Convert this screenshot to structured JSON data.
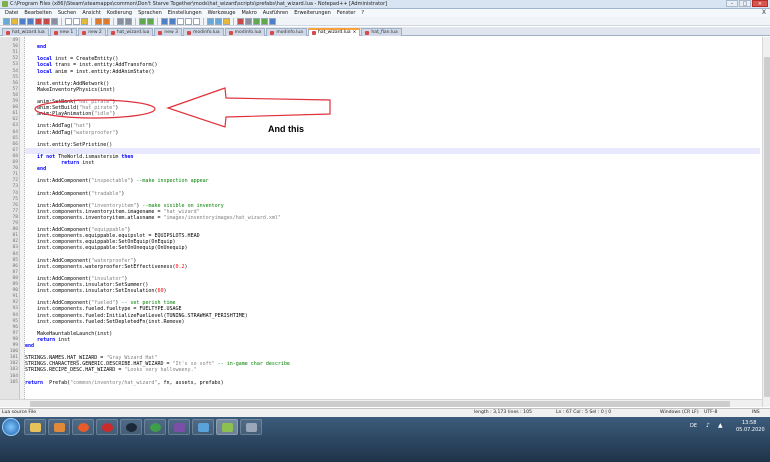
{
  "window": {
    "title": "C:\\Program Files (x86)\\Steam\\steamapps\\common\\Don't Starve Together\\mods\\hat_wizard\\scripts\\prefabs\\hat_wizard.lua - Notepad++ [Administrator]",
    "controls": [
      "–",
      "□",
      "×"
    ]
  },
  "menu": {
    "items": [
      "Datei",
      "Bearbeiten",
      "Suchen",
      "Ansicht",
      "Kodierung",
      "Sprachen",
      "Einstellungen",
      "Werkzeuge",
      "Makro",
      "Ausführen",
      "Erweiterungen",
      "Fenster",
      "?"
    ],
    "close": "X"
  },
  "tabs": [
    {
      "label": "hat_wizard.lua",
      "active": false
    },
    {
      "label": "new 1",
      "active": false
    },
    {
      "label": "new 2",
      "active": false
    },
    {
      "label": "hat_wizard.lua",
      "active": false
    },
    {
      "label": "new 3",
      "active": false
    },
    {
      "label": "modinfo.lua",
      "active": false
    },
    {
      "label": "modinfo.lua",
      "active": false
    },
    {
      "label": "modinfo.lua",
      "active": false
    },
    {
      "label": "hat_wizard.lua",
      "active": true
    },
    {
      "label": "hat_flan.lua",
      "active": false
    }
  ],
  "editor": {
    "lines": [
      {
        "n": "49",
        "t": ""
      },
      {
        "n": "50",
        "t": "    end"
      },
      {
        "n": "51",
        "t": ""
      },
      {
        "n": "52",
        "t": "    local inst = CreateEntity()"
      },
      {
        "n": "53",
        "t": "    local trans = inst.entity:AddTransform()"
      },
      {
        "n": "54",
        "t": "    local anim = inst.entity:AddAnimState()"
      },
      {
        "n": "55",
        "t": ""
      },
      {
        "n": "56",
        "t": "    inst.entity:AddNetwork()"
      },
      {
        "n": "57",
        "t": "    MakeInventoryPhysics(inst)"
      },
      {
        "n": "58",
        "t": ""
      },
      {
        "n": "59",
        "t": "    anim:SetBank(\"hat_pirate\")"
      },
      {
        "n": "60",
        "t": "    anim:SetBuild(\"hat_pirate\")"
      },
      {
        "n": "61",
        "t": "    anim:PlayAnimation(\"idle\")"
      },
      {
        "n": "62",
        "t": ""
      },
      {
        "n": "63",
        "t": "    inst:AddTag(\"hat\")"
      },
      {
        "n": "64",
        "t": "    inst:AddTag(\"waterproofer\")"
      },
      {
        "n": "65",
        "t": ""
      },
      {
        "n": "66",
        "t": "    inst.entity:SetPristine()"
      },
      {
        "n": "67",
        "t": ""
      },
      {
        "n": "68",
        "t": "    if not TheWorld.ismastersim then"
      },
      {
        "n": "69",
        "t": "            return inst"
      },
      {
        "n": "70",
        "t": "    end"
      },
      {
        "n": "71",
        "t": ""
      },
      {
        "n": "72",
        "t": "    inst:AddComponent(\"inspectable\") --make inspection appear"
      },
      {
        "n": "73",
        "t": ""
      },
      {
        "n": "74",
        "t": "    inst:AddComponent(\"tradable\")"
      },
      {
        "n": "75",
        "t": ""
      },
      {
        "n": "76",
        "t": "    inst:AddComponent(\"inventoryitem\") --make visible on inventory"
      },
      {
        "n": "77",
        "t": "    inst.components.inventoryitem.imagename = \"hat_wizard\""
      },
      {
        "n": "78",
        "t": "    inst.components.inventoryitem.atlasname = \"images/inventoryimages/hat_wizard.xml\""
      },
      {
        "n": "79",
        "t": ""
      },
      {
        "n": "80",
        "t": "    inst:AddComponent(\"equippable\")"
      },
      {
        "n": "81",
        "t": "    inst.components.equippable.equipslot = EQUIPSLOTS.HEAD"
      },
      {
        "n": "82",
        "t": "    inst.components.equippable:SetOnEquip(OnEquip)"
      },
      {
        "n": "83",
        "t": "    inst.components.equippable:SetOnUnequip(OnUnequip)"
      },
      {
        "n": "84",
        "t": ""
      },
      {
        "n": "85",
        "t": "    inst:AddComponent(\"waterproofer\")"
      },
      {
        "n": "86",
        "t": "    inst.components.waterproofer:SetEffectiveness(0.2)"
      },
      {
        "n": "87",
        "t": ""
      },
      {
        "n": "88",
        "t": "    inst:AddComponent(\"insulator\")"
      },
      {
        "n": "89",
        "t": "    inst.components.insulator:SetSummer()"
      },
      {
        "n": "90",
        "t": "    inst.components.insulator:SetInsulation(60)"
      },
      {
        "n": "91",
        "t": ""
      },
      {
        "n": "92",
        "t": "    inst:AddComponent(\"fueled\") -- set perish time"
      },
      {
        "n": "93",
        "t": "    inst.components.fueled.fueltype = FUELTYPE.USAGE"
      },
      {
        "n": "94",
        "t": "    inst.components.fueled:InitializeFuelLevel(TUNING.STRAWHAT_PERISHTIME)"
      },
      {
        "n": "95",
        "t": "    inst.components.fueled:SetDepletedFn(inst.Remove)"
      },
      {
        "n": "96",
        "t": ""
      },
      {
        "n": "97",
        "t": "    MakeHauntableLaunch(inst)"
      },
      {
        "n": "98",
        "t": "    return inst"
      },
      {
        "n": "99",
        "t": "end"
      },
      {
        "n": "100",
        "t": ""
      },
      {
        "n": "101",
        "t": "STRINGS.NAMES.HAT_WIZARD = \"Gray Wizard Hat\""
      },
      {
        "n": "102",
        "t": "STRINGS.CHARACTERS.GENERIC.DESCRIBE.HAT_WIZARD = \"It's so soft\" -- in-game char describe"
      },
      {
        "n": "103",
        "t": "STRINGS.RECIPE_DESC.HAT_WIZARD = \"Looks very halloweeny.\""
      },
      {
        "n": "104",
        "t": ""
      },
      {
        "n": "105",
        "t": "return  Prefab(\"common/inventory/hat_wizard\", fn, assets, prefabs)"
      }
    ],
    "current_line": "67"
  },
  "annotation": {
    "label": "And this",
    "ellipse_color": "#e0303a",
    "arrow_color": "#e0303a"
  },
  "status": {
    "file_type": "Lua source File",
    "length": "length : 3,173",
    "lines": "lines : 105",
    "position": "Ln : 67    Col : 5    Sel : 0 | 0",
    "eol": "Windows (CR LF)",
    "encoding": "UTF-8",
    "mode": "INS"
  },
  "taskbar": {
    "apps": [
      "explorer",
      "media",
      "firefox",
      "opera",
      "steam",
      "chrome",
      "app",
      "paint",
      "notepad-plus-plus",
      "screen"
    ],
    "language": "DE",
    "time": "13:58",
    "date": "05.07.2020"
  }
}
